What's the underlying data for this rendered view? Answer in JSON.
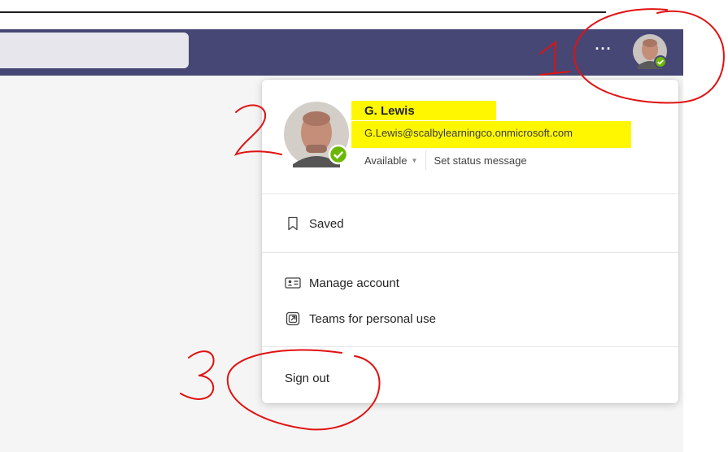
{
  "header": {
    "more_options_label": "···"
  },
  "profile_card": {
    "name": "G. Lewis",
    "email": "G.Lewis@scalbylearningco.onmicrosoft.com",
    "status_label": "Available",
    "status_message_label": "Set status message",
    "presence_color": "#6bb700",
    "highlight_color": "#fff700"
  },
  "menu": {
    "saved": {
      "label": "Saved",
      "icon": "bookmark-icon"
    },
    "manage_account": {
      "label": "Manage account",
      "icon": "contact-card-icon"
    },
    "teams_personal": {
      "label": "Teams for personal use",
      "icon": "open-external-icon"
    },
    "sign_out": {
      "label": "Sign out"
    }
  },
  "annotations": {
    "step_1": "1",
    "step_2": "2",
    "step_3": "3",
    "ink_color": "#e01212"
  },
  "theme": {
    "teams_purple": "#464775"
  }
}
